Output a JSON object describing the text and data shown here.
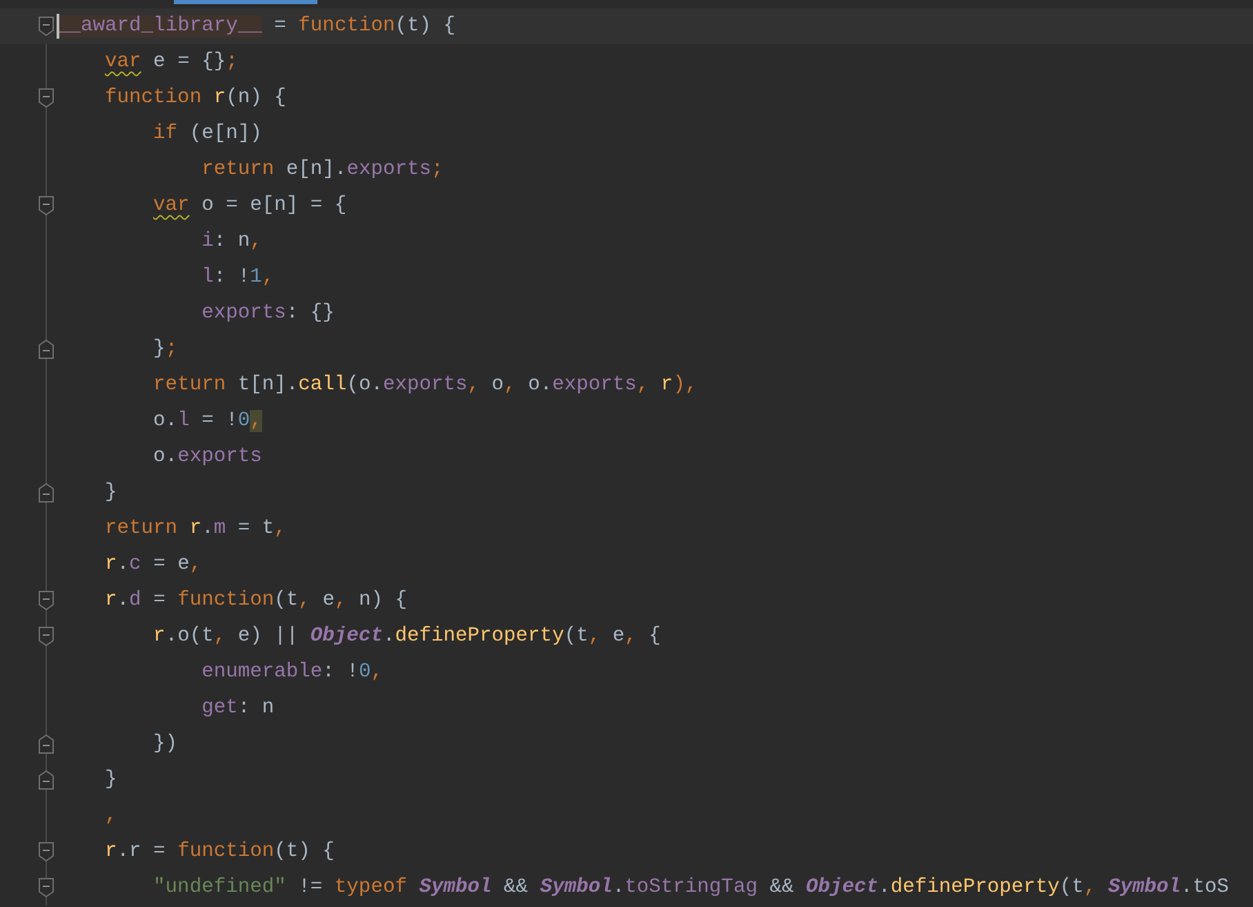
{
  "editor": {
    "lines": [
      {
        "fold_start": true,
        "current": true,
        "tokens": [
          {
            "text": "__award_library__",
            "kind": "highlight"
          },
          {
            "text": " = ",
            "kind": "plain"
          },
          {
            "text": "function",
            "kind": "keyword"
          },
          {
            "text": "(t) {",
            "kind": "plain"
          }
        ],
        "children": [
          {
            "tokens": [
              {
                "text": "var",
                "kind": "warn"
              },
              {
                "text": " e = {}",
                "kind": "plain"
              },
              {
                "text": ";",
                "kind": "keyword"
              }
            ]
          },
          {
            "fold_start": true,
            "tokens": [
              {
                "text": "function ",
                "kind": "keyword"
              },
              {
                "text": "r",
                "kind": "func"
              },
              {
                "text": "(n) {",
                "kind": "plain"
              }
            ],
            "children": [
              {
                "tokens": [
                  {
                    "text": "if ",
                    "kind": "keyword"
                  },
                  {
                    "text": "(e[n])",
                    "kind": "plain"
                  }
                ],
                "children": [
                  {
                    "tokens": [
                      {
                        "text": "return ",
                        "kind": "keyword"
                      },
                      {
                        "text": "e[n].",
                        "kind": "plain"
                      },
                      {
                        "text": "exports",
                        "kind": "prop"
                      },
                      {
                        "text": ";",
                        "kind": "keyword"
                      }
                    ]
                  }
                ]
              },
              {
                "fold_start": true,
                "tokens": [
                  {
                    "text": "var",
                    "kind": "warn"
                  },
                  {
                    "text": " o = e[n] = {",
                    "kind": "plain"
                  }
                ],
                "children": [
                  {
                    "tokens": [
                      {
                        "text": "i",
                        "kind": "prop"
                      },
                      {
                        "text": ": n",
                        "kind": "plain"
                      },
                      {
                        "text": ",",
                        "kind": "keyword"
                      }
                    ]
                  },
                  {
                    "tokens": [
                      {
                        "text": "l",
                        "kind": "prop"
                      },
                      {
                        "text": ": !",
                        "kind": "plain"
                      },
                      {
                        "text": "1",
                        "kind": "num"
                      },
                      {
                        "text": ",",
                        "kind": "keyword"
                      }
                    ]
                  },
                  {
                    "tokens": [
                      {
                        "text": "exports",
                        "kind": "prop"
                      },
                      {
                        "text": ": {}",
                        "kind": "plain"
                      }
                    ]
                  }
                ]
              },
              {
                "fold_end": true,
                "tokens": [
                  {
                    "text": "}",
                    "kind": "plain"
                  },
                  {
                    "text": ";",
                    "kind": "keyword"
                  }
                ]
              },
              {
                "tokens": [
                  {
                    "text": "return ",
                    "kind": "keyword"
                  },
                  {
                    "text": "t[n].",
                    "kind": "plain"
                  },
                  {
                    "text": "call",
                    "kind": "func"
                  },
                  {
                    "text": "(o.",
                    "kind": "plain"
                  },
                  {
                    "text": "exports",
                    "kind": "prop"
                  },
                  {
                    "text": ", ",
                    "kind": "keyword"
                  },
                  {
                    "text": "o",
                    "kind": "plain"
                  },
                  {
                    "text": ", ",
                    "kind": "keyword"
                  },
                  {
                    "text": "o.",
                    "kind": "plain"
                  },
                  {
                    "text": "exports",
                    "kind": "prop"
                  },
                  {
                    "text": ", ",
                    "kind": "keyword"
                  },
                  {
                    "text": "r",
                    "kind": "func"
                  },
                  {
                    "text": "),",
                    "kind": "keyword"
                  }
                ]
              },
              {
                "tokens": [
                  {
                    "text": "o.",
                    "kind": "plain"
                  },
                  {
                    "text": "l",
                    "kind": "prop"
                  },
                  {
                    "text": " = !",
                    "kind": "plain"
                  },
                  {
                    "text": "0",
                    "kind": "num"
                  },
                  {
                    "text": ",",
                    "kind": "match"
                  }
                ]
              },
              {
                "tokens": [
                  {
                    "text": "o.",
                    "kind": "plain"
                  },
                  {
                    "text": "exports",
                    "kind": "prop"
                  }
                ]
              }
            ]
          },
          {
            "fold_end": true,
            "tokens": [
              {
                "text": "}",
                "kind": "plain"
              }
            ]
          },
          {
            "tokens": [
              {
                "text": "return ",
                "kind": "keyword"
              },
              {
                "text": "r",
                "kind": "func"
              },
              {
                "text": ".",
                "kind": "plain"
              },
              {
                "text": "m",
                "kind": "prop"
              },
              {
                "text": " = t",
                "kind": "plain"
              },
              {
                "text": ",",
                "kind": "keyword"
              }
            ]
          },
          {
            "tokens": [
              {
                "text": "r",
                "kind": "func"
              },
              {
                "text": ".",
                "kind": "plain"
              },
              {
                "text": "c",
                "kind": "prop"
              },
              {
                "text": " = e",
                "kind": "plain"
              },
              {
                "text": ",",
                "kind": "keyword"
              }
            ]
          },
          {
            "fold_start": true,
            "tokens": [
              {
                "text": "r",
                "kind": "func"
              },
              {
                "text": ".",
                "kind": "plain"
              },
              {
                "text": "d",
                "kind": "prop"
              },
              {
                "text": " = ",
                "kind": "plain"
              },
              {
                "text": "function",
                "kind": "keyword"
              },
              {
                "text": "(t",
                "kind": "plain"
              },
              {
                "text": ", ",
                "kind": "keyword"
              },
              {
                "text": "e",
                "kind": "plain"
              },
              {
                "text": ", ",
                "kind": "keyword"
              },
              {
                "text": "n) {",
                "kind": "plain"
              }
            ],
            "children": [
              {
                "fold_start": true,
                "tokens": [
                  {
                    "text": "r",
                    "kind": "func"
                  },
                  {
                    "text": ".o(t",
                    "kind": "plain"
                  },
                  {
                    "text": ", ",
                    "kind": "keyword"
                  },
                  {
                    "text": "e) || ",
                    "kind": "plain"
                  },
                  {
                    "text": "Object",
                    "kind": "class"
                  },
                  {
                    "text": ".",
                    "kind": "plain"
                  },
                  {
                    "text": "defineProperty",
                    "kind": "func"
                  },
                  {
                    "text": "(t",
                    "kind": "plain"
                  },
                  {
                    "text": ", ",
                    "kind": "keyword"
                  },
                  {
                    "text": "e",
                    "kind": "plain"
                  },
                  {
                    "text": ", ",
                    "kind": "keyword"
                  },
                  {
                    "text": "{",
                    "kind": "plain"
                  }
                ],
                "children": [
                  {
                    "tokens": [
                      {
                        "text": "enumerable",
                        "kind": "prop"
                      },
                      {
                        "text": ": !",
                        "kind": "plain"
                      },
                      {
                        "text": "0",
                        "kind": "num"
                      },
                      {
                        "text": ",",
                        "kind": "keyword"
                      }
                    ]
                  },
                  {
                    "tokens": [
                      {
                        "text": "get",
                        "kind": "prop"
                      },
                      {
                        "text": ": n",
                        "kind": "plain"
                      }
                    ]
                  }
                ]
              },
              {
                "fold_end": true,
                "tokens": [
                  {
                    "text": "})",
                    "kind": "plain"
                  }
                ]
              }
            ]
          },
          {
            "fold_end": true,
            "tokens": [
              {
                "text": "}",
                "kind": "plain"
              }
            ]
          },
          {
            "tokens": [
              {
                "text": ",",
                "kind": "keyword"
              }
            ]
          },
          {
            "fold_start": true,
            "tokens": [
              {
                "text": "r",
                "kind": "func"
              },
              {
                "text": ".r = ",
                "kind": "plain"
              },
              {
                "text": "function",
                "kind": "keyword"
              },
              {
                "text": "(t) {",
                "kind": "plain"
              }
            ],
            "children": [
              {
                "fold_start": true,
                "tokens": [
                  {
                    "text": "\"undefined\"",
                    "kind": "string"
                  },
                  {
                    "text": " != ",
                    "kind": "plain"
                  },
                  {
                    "text": "typeof ",
                    "kind": "keyword"
                  },
                  {
                    "text": "Symbol",
                    "kind": "class"
                  },
                  {
                    "text": " && ",
                    "kind": "plain"
                  },
                  {
                    "text": "Symbol",
                    "kind": "class"
                  },
                  {
                    "text": ".",
                    "kind": "plain"
                  },
                  {
                    "text": "toStringTag",
                    "kind": "prop"
                  },
                  {
                    "text": " && ",
                    "kind": "plain"
                  },
                  {
                    "text": "Object",
                    "kind": "class"
                  },
                  {
                    "text": ".",
                    "kind": "plain"
                  },
                  {
                    "text": "defineProperty",
                    "kind": "func"
                  },
                  {
                    "text": "(t",
                    "kind": "plain"
                  },
                  {
                    "text": ", ",
                    "kind": "keyword"
                  },
                  {
                    "text": "Symbol",
                    "kind": "class"
                  },
                  {
                    "text": ".toS",
                    "kind": "plain"
                  }
                ]
              }
            ]
          }
        ]
      }
    ]
  }
}
